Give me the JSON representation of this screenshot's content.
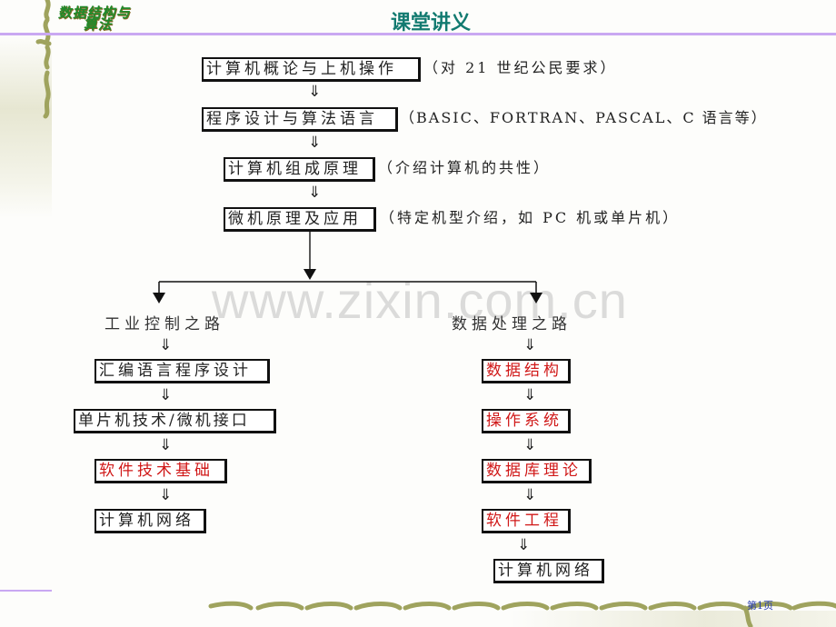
{
  "header": {
    "logo_line1": "数据结构与",
    "logo_line2": "算法",
    "title": "课堂讲义"
  },
  "colors": {
    "title": "#127a70",
    "rule": "#c9a8f2",
    "highlight_text": "#d01818",
    "page_number": "#2a3fb0",
    "vine": "#9fa35e"
  },
  "arrow_glyph": "⇓",
  "main_path": [
    {
      "label": "计算机概论与上机操作",
      "note": "（对 21 世纪公民要求）"
    },
    {
      "label": "程序设计与算法语言",
      "note": "（BASIC、FORTRAN、PASCAL、C 语言等）"
    },
    {
      "label": "计算机组成原理",
      "note": "（介绍计算机的共性）"
    },
    {
      "label": "微机原理及应用",
      "note": "（特定机型介绍，如 PC 机或单片机）"
    }
  ],
  "branches": {
    "left": {
      "title": "工业控制之路",
      "steps": [
        {
          "label": "汇编语言程序设计",
          "highlight": false
        },
        {
          "label": "单片机技术/微机接口",
          "highlight": false
        },
        {
          "label": "软件技术基础",
          "highlight": true
        },
        {
          "label": "计算机网络",
          "highlight": false
        }
      ]
    },
    "right": {
      "title": "数据处理之路",
      "steps": [
        {
          "label": "数据结构",
          "highlight": true
        },
        {
          "label": "操作系统",
          "highlight": true
        },
        {
          "label": "数据库理论",
          "highlight": true
        },
        {
          "label": "软件工程",
          "highlight": true
        },
        {
          "label": "计算机网络",
          "highlight": false
        }
      ]
    }
  },
  "watermark": "www.zixin.com.cn",
  "footer": {
    "page_number": "第1页"
  }
}
